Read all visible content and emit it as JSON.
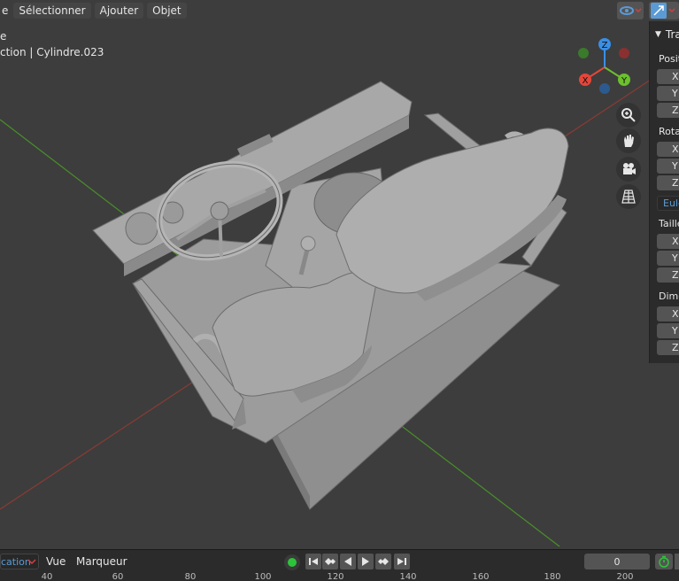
{
  "menubar": {
    "items": [
      {
        "label": "e"
      },
      {
        "label": "Sélectionner"
      },
      {
        "label": "Ajouter"
      },
      {
        "label": "Objet"
      }
    ]
  },
  "viewport_info": {
    "line1": "e",
    "line2": "ction | Cylindre.023"
  },
  "gizmo": {
    "x_label": "X",
    "y_label": "Y",
    "z_label": "Z",
    "x_color": "#e5463a",
    "y_color": "#6cbf2e",
    "z_color": "#3a8fe5"
  },
  "nav_buttons": [
    {
      "icon": "zoom-icon"
    },
    {
      "icon": "hand-pan-icon"
    },
    {
      "icon": "camera-icon"
    },
    {
      "icon": "grid-perspective-icon"
    }
  ],
  "npanel": {
    "header": "Tra",
    "groups": [
      {
        "label": "Positi",
        "axes": [
          "X",
          "Y",
          "Z"
        ]
      },
      {
        "label": "Rotat",
        "axes": [
          "X",
          "Y",
          "Z"
        ]
      },
      {
        "label": "Taille",
        "axes": [
          "X",
          "Y",
          "Z"
        ]
      },
      {
        "label": "Dime",
        "axes": [
          "X",
          "Y",
          "Z"
        ]
      }
    ],
    "rotation_mode": "Eule"
  },
  "timeline": {
    "mode_select": "cation",
    "menu": [
      "Vue",
      "Marqueur"
    ],
    "current_frame": "0",
    "ruler_ticks": [
      "40",
      "60",
      "80",
      "100",
      "120",
      "140",
      "160",
      "180",
      "200"
    ]
  },
  "colors": {
    "background": "#3d3d3d",
    "header": "#2b2b2b",
    "x_axis_line": "#8a3b34",
    "y_axis_line": "#4a8f2a",
    "accent_blue": "#5b9bd5",
    "mesh": "#9a9a9a"
  }
}
